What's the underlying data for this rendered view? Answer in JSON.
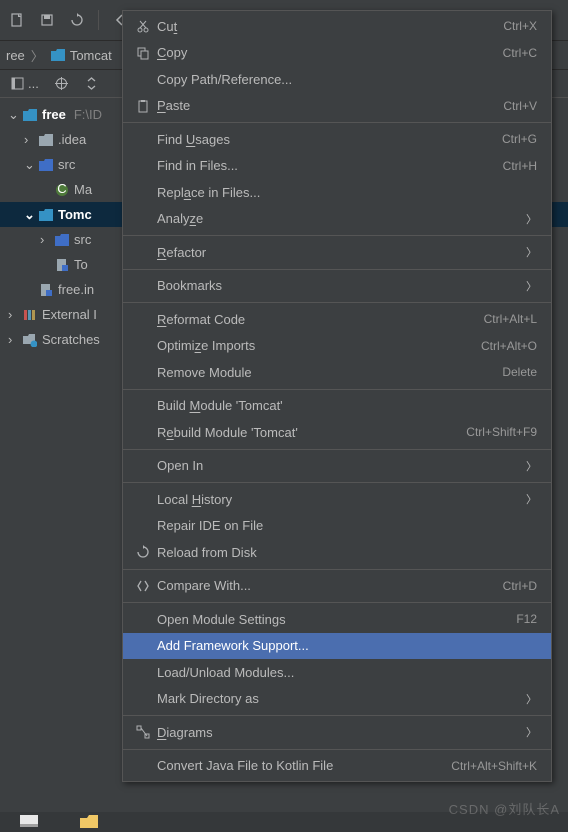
{
  "toolbar": {
    "newFile": "new-file",
    "save": "save-all",
    "sync": "sync",
    "back": "back"
  },
  "breadcrumb": {
    "parts": [
      "ree",
      "Tomcat"
    ]
  },
  "projTabs": {
    "ellipsis": "..."
  },
  "tree": {
    "free": "free",
    "freePath": "F:\\ID",
    "idea": ".idea",
    "src": "src",
    "ma": "Ma",
    "tomcat": "Tomc",
    "src2": "src",
    "to": "To",
    "freein": "free.in",
    "external": "External I",
    "scratches": "Scratches"
  },
  "menu": {
    "cut": "Cut",
    "cutKey": "Ctrl+X",
    "copy": "Copy",
    "copyKey": "Ctrl+C",
    "copyPath": "Copy Path/Reference...",
    "paste": "Paste",
    "pasteKey": "Ctrl+V",
    "findUsages": "Find Usages",
    "findUsagesKey": "Ctrl+G",
    "findInFiles": "Find in Files...",
    "findInFilesKey": "Ctrl+H",
    "replaceInFiles": "Replace in Files...",
    "analyze": "Analyze",
    "refactor": "Refactor",
    "bookmarks": "Bookmarks",
    "reformat": "Reformat Code",
    "reformatKey": "Ctrl+Alt+L",
    "optimize": "Optimize Imports",
    "optimizeKey": "Ctrl+Alt+O",
    "removeModule": "Remove Module",
    "removeKey": "Delete",
    "buildModule": "Build Module 'Tomcat'",
    "rebuildModule": "Rebuild Module 'Tomcat'",
    "rebuildKey": "Ctrl+Shift+F9",
    "openIn": "Open In",
    "localHistory": "Local History",
    "repairIDE": "Repair IDE on File",
    "reload": "Reload from Disk",
    "compareWith": "Compare With...",
    "compareKey": "Ctrl+D",
    "openModuleSettings": "Open Module Settings",
    "openModuleKey": "F12",
    "addFramework": "Add Framework Support...",
    "loadUnload": "Load/Unload Modules...",
    "markDirectory": "Mark Directory as",
    "diagrams": "Diagrams",
    "convertKotlin": "Convert Java File to Kotlin File",
    "convertKotlinKey": "Ctrl+Alt+Shift+K"
  },
  "watermark": "CSDN @刘队长A"
}
